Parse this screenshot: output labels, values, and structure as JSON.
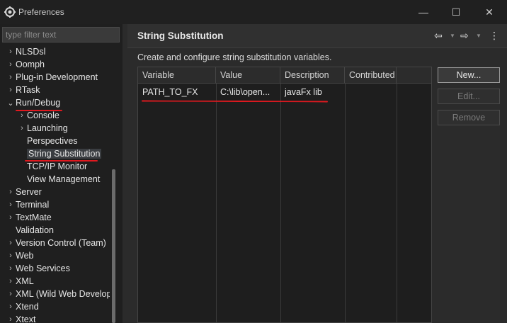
{
  "window": {
    "title": "Preferences",
    "minimize_glyph": "—",
    "maximize_glyph": "☐",
    "close_glyph": "✕"
  },
  "filter": {
    "placeholder": "type filter text"
  },
  "tree": {
    "items": [
      {
        "label": "NLSDsl",
        "chev": "›"
      },
      {
        "label": "Oomph",
        "chev": "›"
      },
      {
        "label": "Plug-in Development",
        "chev": "›"
      },
      {
        "label": "RTask",
        "chev": "›"
      },
      {
        "label": "Run/Debug",
        "chev": "⌄"
      },
      {
        "label": "Console",
        "chev": "›"
      },
      {
        "label": "Launching",
        "chev": "›"
      },
      {
        "label": "Perspectives",
        "chev": ""
      },
      {
        "label": "String Substitution",
        "chev": ""
      },
      {
        "label": "TCP/IP Monitor",
        "chev": ""
      },
      {
        "label": "View Management",
        "chev": ""
      },
      {
        "label": "Server",
        "chev": "›"
      },
      {
        "label": "Terminal",
        "chev": "›"
      },
      {
        "label": "TextMate",
        "chev": "›"
      },
      {
        "label": "Validation",
        "chev": ""
      },
      {
        "label": "Version Control (Team)",
        "chev": "›"
      },
      {
        "label": "Web",
        "chev": "›"
      },
      {
        "label": "Web Services",
        "chev": "›"
      },
      {
        "label": "XML",
        "chev": "›"
      },
      {
        "label": "XML (Wild Web Developer)",
        "chev": "›"
      },
      {
        "label": "Xtend",
        "chev": "›"
      },
      {
        "label": "Xtext",
        "chev": "›"
      }
    ]
  },
  "page": {
    "title": "String Substitution",
    "back_glyph": "⇦",
    "forward_glyph": "⇨",
    "menu_glyph": "⋮",
    "dropdown_glyph": "▼",
    "description": "Create and configure string substitution variables."
  },
  "table": {
    "headers": [
      "Variable",
      "Value",
      "Description",
      "Contributed",
      ""
    ],
    "rows": [
      {
        "variable": "PATH_TO_FX",
        "value": "C:\\lib\\open...",
        "description": "javaFx lib",
        "contributed": ""
      }
    ]
  },
  "buttons": {
    "new_label": "New...",
    "edit_label": "Edit...",
    "remove_label": "Remove"
  },
  "colors": {
    "annotation_red": "#e0191f",
    "background": "#2b2b2b"
  }
}
